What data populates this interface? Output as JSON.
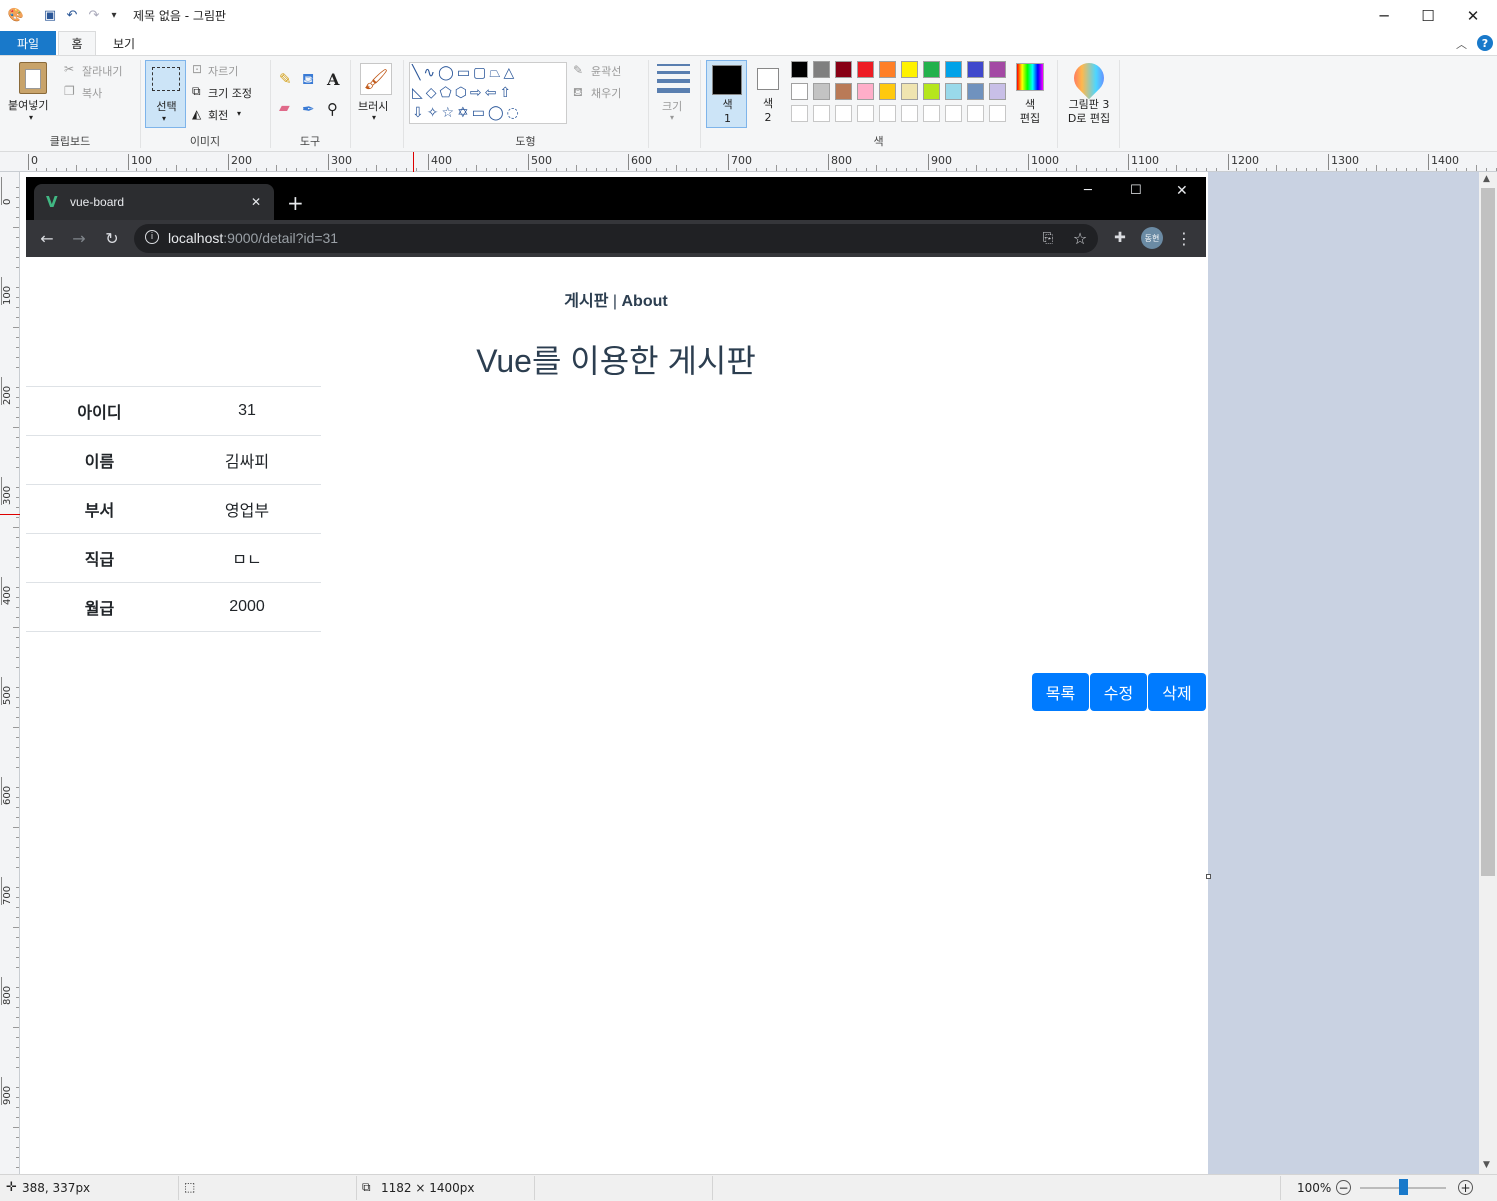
{
  "window": {
    "title": "제목 없음 - 그림판"
  },
  "ribbon": {
    "tabs": [
      "파일",
      "홈",
      "보기"
    ],
    "clipboard": {
      "paste": "붙여넣기",
      "cut": "잘라내기",
      "copy": "복사",
      "label": "클립보드"
    },
    "image": {
      "select": "선택",
      "crop": "자르기",
      "resize": "크기 조정",
      "rotate": "회전",
      "label": "이미지"
    },
    "tools": {
      "label": "도구"
    },
    "brushes": {
      "label": "브러시"
    },
    "shapes": {
      "outline": "윤곽선",
      "fill": "채우기",
      "label": "도형"
    },
    "size": {
      "label": "크기"
    },
    "colors": {
      "color1": "색\n1",
      "color2": "색\n2",
      "edit": "색\n편집",
      "label": "색",
      "palette_row1": [
        "#000000",
        "#7f7f7f",
        "#880015",
        "#ed1c24",
        "#ff7f27",
        "#fff200",
        "#22b14c",
        "#00a2e8",
        "#3f48cc",
        "#a349a4"
      ],
      "palette_row2": [
        "#ffffff",
        "#c3c3c3",
        "#b97a57",
        "#ffaec9",
        "#ffc90e",
        "#efe4b0",
        "#b5e61d",
        "#99d9ea",
        "#7092be",
        "#c8bfe7"
      ]
    },
    "paint3d": {
      "label": "그림판 3\nD로 편집"
    }
  },
  "ruler": {
    "h_labels": [
      "0",
      "100",
      "200",
      "300",
      "400",
      "500",
      "600",
      "700",
      "800",
      "900",
      "1000",
      "1100",
      "1200",
      "1300",
      "1400"
    ],
    "v_labels": [
      "0",
      "100",
      "200",
      "300",
      "400",
      "500",
      "600",
      "700",
      "800",
      "900"
    ]
  },
  "browser": {
    "tab_title": "vue-board",
    "url_host": "localhost",
    "url_rest": ":9000/detail?id=31",
    "profile": "동현"
  },
  "page": {
    "nav_board": "게시판",
    "nav_sep": " | ",
    "nav_about": "About",
    "heading": "Vue를 이용한 게시판",
    "rows": [
      {
        "label": "아이디",
        "value": "31"
      },
      {
        "label": "이름",
        "value": "김싸피"
      },
      {
        "label": "부서",
        "value": "영업부"
      },
      {
        "label": "직급",
        "value": "ㅁㄴ"
      },
      {
        "label": "월급",
        "value": "2000"
      }
    ],
    "buttons": {
      "list": "목록",
      "edit": "수정",
      "delete": "삭제"
    }
  },
  "status": {
    "cursor": "388, 337px",
    "size": "1182 × 1400px",
    "zoom": "100%"
  }
}
